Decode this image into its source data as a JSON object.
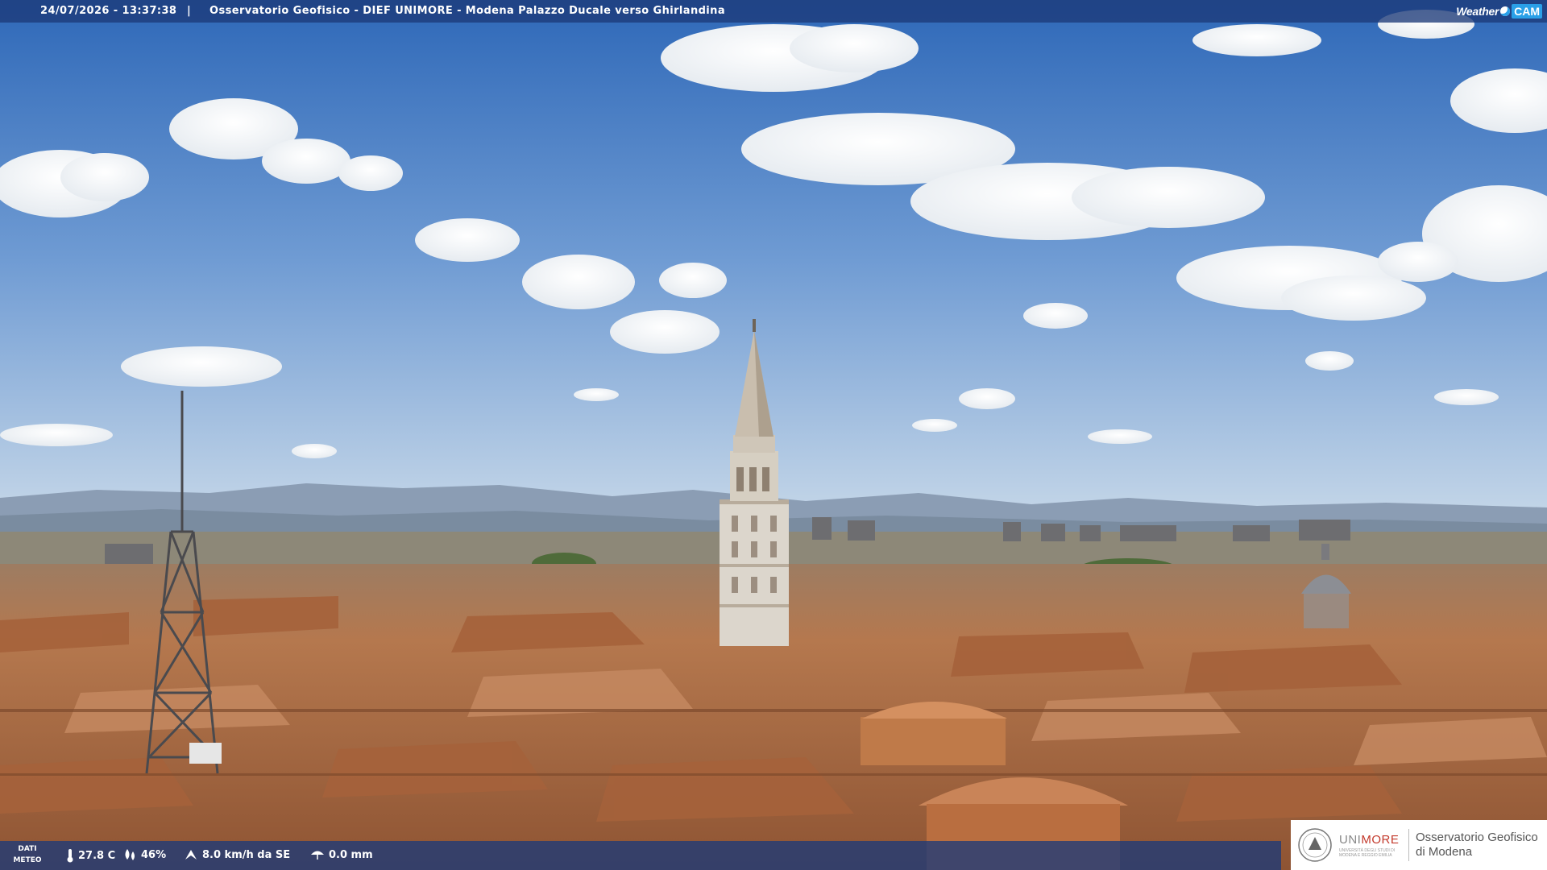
{
  "webcam": {
    "timestamp": "24/07/2026 - 13:37:38",
    "separator": "|",
    "title": "Osservatorio Geofisico - DIEF UNIMORE - Modena Palazzo Ducale verso Ghirlandina",
    "logo": {
      "weather_text": "Weather",
      "cam_text": "CAM"
    }
  },
  "meteo": {
    "label_line1": "DATI",
    "label_line2": "METEO",
    "temperature": "27.8 C",
    "humidity": "46%",
    "wind": "8.0 km/h da SE",
    "rain": "0.0 mm",
    "icons": [
      "thermometer-icon",
      "humidity-icon",
      "wind-icon",
      "rain-icon"
    ]
  },
  "institution": {
    "name_part1": "UNI",
    "name_part2": "MORE",
    "subtitle_line1": "UNIVERSITÀ DEGLI STUDI DI",
    "subtitle_line2": "MODENA E REGGIO EMILIA",
    "observatory_line1": "Osservatorio Geofisico",
    "observatory_line2": "di Modena"
  },
  "colors": {
    "sky_top": "#2e68b8",
    "sky_horizon": "#b9d0e6",
    "roofs": "#b8754a",
    "overlay": "#1c3a78",
    "unimore_red": "#c3392b",
    "accent_blue": "#2aa0e8"
  }
}
